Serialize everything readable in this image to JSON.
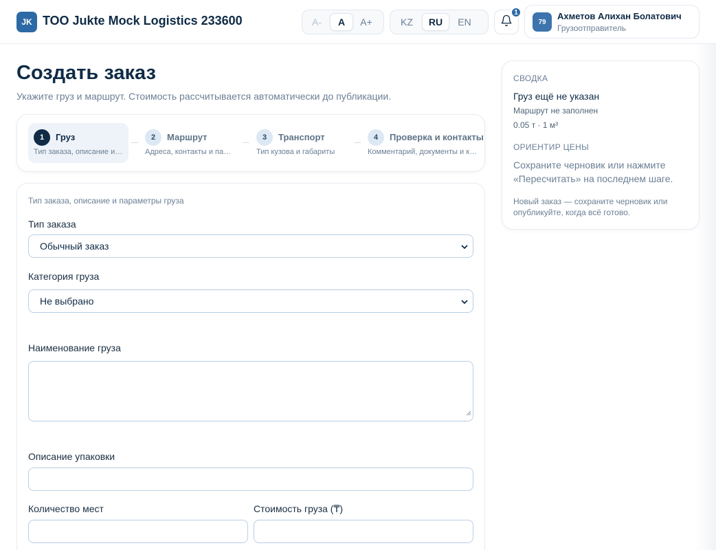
{
  "header": {
    "logo_initials": "JK",
    "company": "ТОО Jukte Mock Logistics 233600",
    "font_sizes": [
      "A-",
      "A",
      "A+"
    ],
    "font_active": "A",
    "languages": [
      "KZ",
      "RU",
      "EN"
    ],
    "language_active": "RU",
    "notifications_count": "1",
    "user": {
      "avatar_text": "79",
      "name": "Ахметов Алихан Болатович",
      "role": "Грузоотправитель"
    }
  },
  "main": {
    "title": "Создать заказ",
    "subtitle": "Укажите груз и маршрут. Стоимость рассчитывается автоматически до публикации.",
    "steps": [
      {
        "num": "1",
        "title": "Груз",
        "desc": "Тип заказа, описание и параметры груза"
      },
      {
        "num": "2",
        "title": "Маршрут",
        "desc": "Адреса, контакты и параметры маршрута"
      },
      {
        "num": "3",
        "title": "Транспорт",
        "desc": "Тип кузова и габариты"
      },
      {
        "num": "4",
        "title": "Проверка и контакты",
        "desc": "Комментарий, документы и контакты"
      }
    ],
    "active_step": 1,
    "form": {
      "section_label": "Тип заказа, описание и параметры груза",
      "order_type_label": "Тип заказа",
      "order_type_value": "Обычный заказ",
      "category_label": "Категория груза",
      "category_value": "Не выбрано",
      "cargo_name_label": "Наименование груза",
      "cargo_name_value": "",
      "packaging_label": "Описание упаковки",
      "packaging_value": "",
      "places_label": "Количество мест",
      "places_value": "",
      "cost_label": "Стоимость груза (₸)",
      "cost_value": ""
    }
  },
  "summary": {
    "heading": "СВОДКА",
    "cargo_status": "Груз ещё не указан",
    "route_status": "Маршрут не заполнен",
    "weight_volume": "0.05 т · 1 м³",
    "price_heading": "ОРИЕНТИР ЦЕНЫ",
    "price_text": "Сохраните черновик или нажмите «Пересчитать» на последнем шаге.",
    "note": "Новый заказ — сохраните черновик или опубликуйте, когда всё готово."
  },
  "colors": {
    "primary": "#0f2b46",
    "accent": "#2d6aa5",
    "muted": "#6b7f95",
    "border": "#e6ebf1",
    "input_border": "#b9cee3"
  }
}
